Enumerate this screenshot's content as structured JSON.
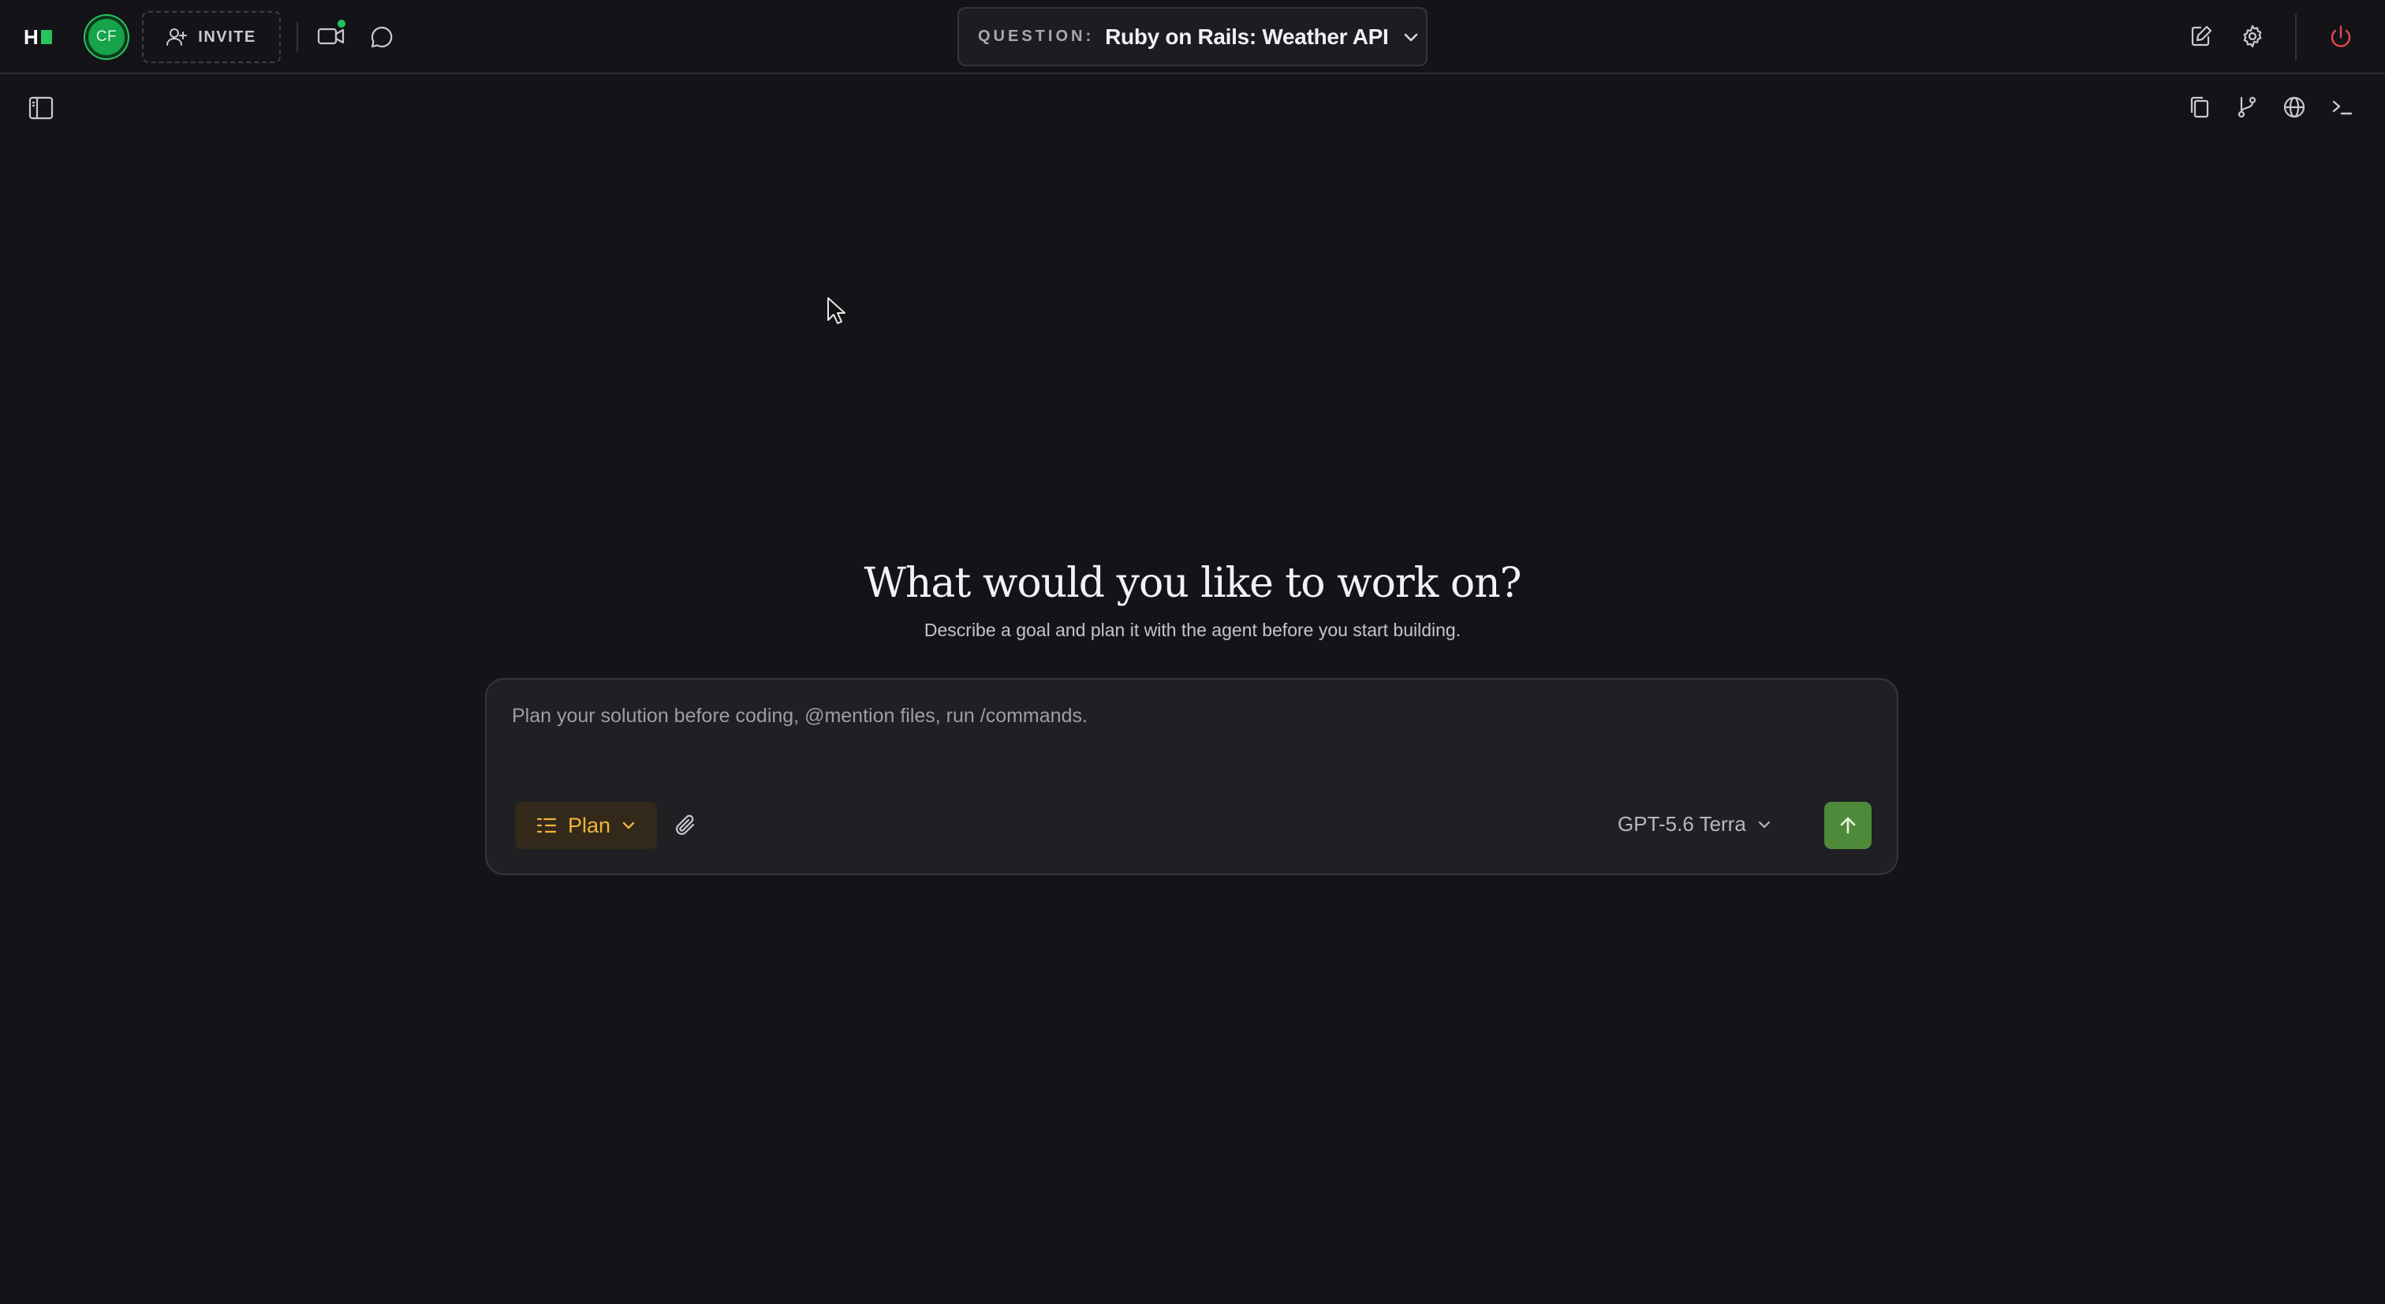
{
  "app": {
    "logo_letter": "H",
    "accent": "#28c35d"
  },
  "header": {
    "avatar_initials": "CF",
    "invite_label": "INVITE",
    "question_label": "QUESTION:",
    "question_value": "Ruby on Rails: Weather API"
  },
  "icons": {
    "invite": "person-plus-icon",
    "video": "video-camera-icon",
    "chat": "chat-bubble-icon",
    "notes": "edit-note-icon",
    "settings": "gear-icon",
    "power": "power-icon",
    "sidebar": "sidebar-toggle-icon",
    "copy": "copy-icon",
    "branch": "git-branch-icon",
    "globe": "globe-icon",
    "terminal": "terminal-icon",
    "attach": "paperclip-icon",
    "send": "arrow-up-icon"
  },
  "main": {
    "title": "What would you like to work on?",
    "subtitle": "Describe a goal and plan it with the agent before you start building."
  },
  "composer": {
    "placeholder": "Plan your solution before coding, @mention files, run /commands.",
    "mode_label": "Plan",
    "model_label": "GPT-5.6 Terra"
  },
  "colors": {
    "background": "#141418",
    "plan_text": "#f0b43a",
    "send_button": "#4f8a3b",
    "power": "#e5484d",
    "status_dot": "#22c55e"
  }
}
